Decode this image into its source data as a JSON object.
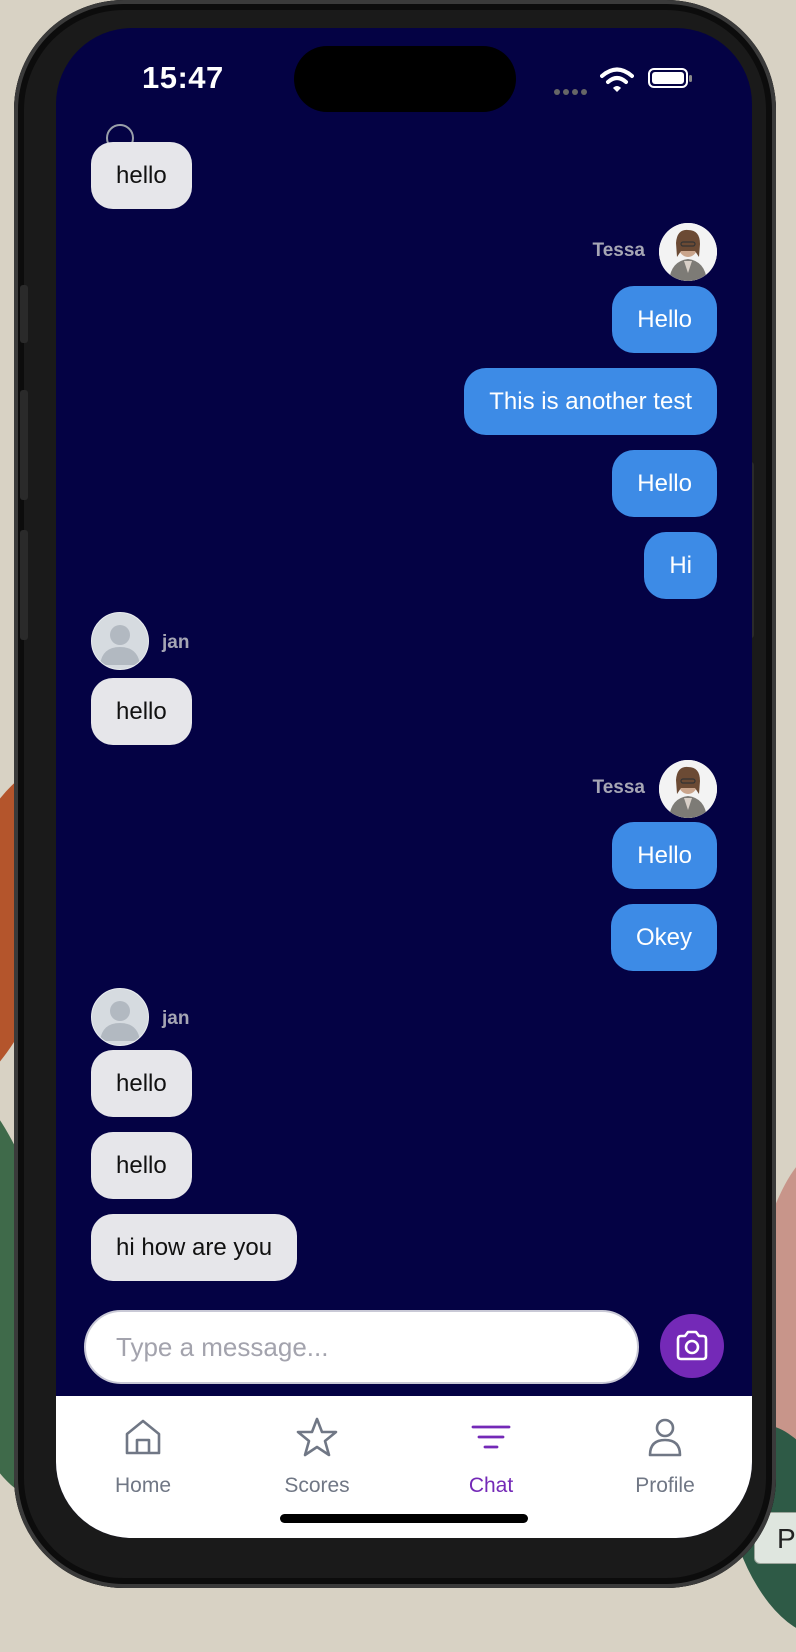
{
  "status": {
    "time": "15:47"
  },
  "messages": [
    {
      "sender": "jan",
      "text": "hello"
    },
    {
      "sender": "Tessa",
      "text": "Hello"
    },
    {
      "sender": "Tessa",
      "text": "This is another test"
    },
    {
      "sender": "Tessa",
      "text": "Hello"
    },
    {
      "sender": "Tessa",
      "text": "Hi"
    },
    {
      "sender": "jan",
      "text": "hello"
    },
    {
      "sender": "Tessa",
      "text": "Hello"
    },
    {
      "sender": "Tessa",
      "text": "Okey"
    },
    {
      "sender": "jan",
      "text": "hello"
    },
    {
      "sender": "jan",
      "text": "hello"
    },
    {
      "sender": "jan",
      "text": "hi how are you"
    }
  ],
  "senders": {
    "tessa": "Tessa",
    "jan": "jan"
  },
  "composer": {
    "placeholder": "Type a message..."
  },
  "tabs": [
    {
      "label": "Home",
      "icon": "home-icon"
    },
    {
      "label": "Scores",
      "icon": "star-icon"
    },
    {
      "label": "Chat",
      "icon": "chat-filter-icon",
      "active": true
    },
    {
      "label": "Profile",
      "icon": "person-icon"
    }
  ],
  "side_chip": "P",
  "colors": {
    "background": "#040244",
    "outgoing": "#3d8be6",
    "incoming": "#e6e6ea",
    "accent": "#7429b7"
  }
}
